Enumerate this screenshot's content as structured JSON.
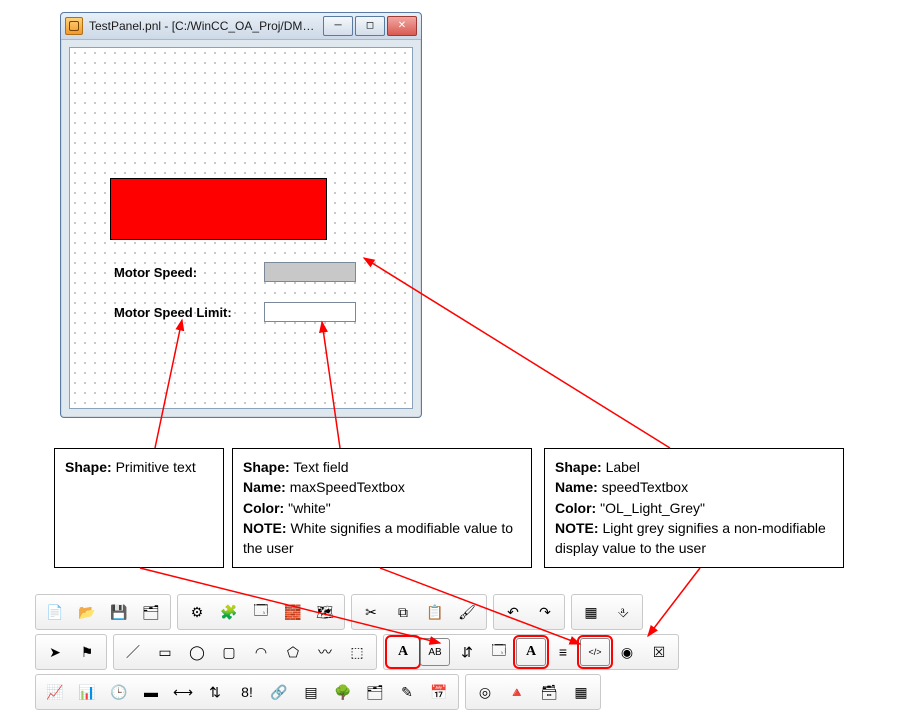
{
  "window": {
    "title": "TestPanel.pnl - [C:/WinCC_OA_Proj/DMC_Tutorial/panel..."
  },
  "panel": {
    "motor_speed_label": "Motor Speed:",
    "motor_speed_limit_label": "Motor Speed Limit:"
  },
  "callouts": {
    "primitive_text": {
      "shape_key": "Shape:",
      "shape_val": "Primitive text"
    },
    "text_field": {
      "shape_key": "Shape:",
      "shape_val": "Text field",
      "name_key": "Name:",
      "name_val": "maxSpeedTextbox",
      "color_key": "Color:",
      "color_val": "\"white\"",
      "note_key": "NOTE:",
      "note_val": "White signifies a modifiable value to the user"
    },
    "label_shape": {
      "shape_key": "Shape:",
      "shape_val": "Label",
      "name_key": "Name:",
      "name_val": "speedTextbox",
      "color_key": "Color:",
      "color_val": "\"OL_Light_Grey\"",
      "note_key": "NOTE:",
      "note_val": "Light grey signifies a non-modifiable display value to the user"
    }
  },
  "toolbar_icons": {
    "row1": [
      "new-file-icon",
      "open-folder-icon",
      "save-icon",
      "save-all-icon",
      "gear-icon",
      "module-icon",
      "panel-manager-icon",
      "tree-icon",
      "hierarchy-icon",
      "cut-icon",
      "copy-icon",
      "paste-icon",
      "format-painter-icon",
      "undo-icon",
      "redo-icon",
      "snap-grid-icon",
      "anchor-icon"
    ],
    "row2": [
      "pointer-icon",
      "flag-icon",
      "line-icon",
      "rectangle-icon",
      "ellipse-icon",
      "rounded-rect-icon",
      "arc-icon",
      "polygon-icon",
      "freeform-icon",
      "button-icon",
      "primitive-text-icon",
      "text-field-icon",
      "spin-icon",
      "frame-icon",
      "label-icon",
      "combobox-icon",
      "code-label-icon",
      "radio-icon",
      "close-x-icon"
    ],
    "row3": [
      "trend-icon",
      "bar-chart-icon",
      "clock-icon",
      "progress-icon",
      "slider-icon",
      "spin-box-icon",
      "numeric-io-icon",
      "link-icon",
      "table-icon",
      "tree-view-icon",
      "tab-icon",
      "script-editor-icon",
      "calendar-icon",
      "radio-dot-icon",
      "cone-icon",
      "layers-icon",
      "grid-table-icon"
    ]
  },
  "glyphs": {
    "new-file-icon": "📄",
    "open-folder-icon": "📂",
    "save-icon": "💾",
    "save-all-icon": "🗂",
    "gear-icon": "⚙",
    "module-icon": "🧩",
    "panel-manager-icon": "🗔",
    "tree-icon": "🧱",
    "hierarchy-icon": "🗺",
    "cut-icon": "✂",
    "copy-icon": "⧉",
    "paste-icon": "📋",
    "format-painter-icon": "🖌",
    "undo-icon": "↶",
    "redo-icon": "↷",
    "snap-grid-icon": "▦",
    "anchor-icon": "⎀",
    "pointer-icon": "➤",
    "flag-icon": "⚑",
    "line-icon": "／",
    "rectangle-icon": "▭",
    "ellipse-icon": "◯",
    "rounded-rect-icon": "▢",
    "arc-icon": "◠",
    "polygon-icon": "⬠",
    "freeform-icon": "〰",
    "button-icon": "⬚",
    "primitive-text-icon": "A",
    "text-field-icon": "AB",
    "spin-icon": "⇵",
    "frame-icon": "🗔",
    "label-icon": "A",
    "combobox-icon": "≡",
    "code-label-icon": "</>",
    "radio-icon": "◉",
    "close-x-icon": "☒",
    "trend-icon": "📈",
    "bar-chart-icon": "📊",
    "clock-icon": "🕒",
    "progress-icon": "▬",
    "slider-icon": "⟷",
    "spin-box-icon": "⇅",
    "numeric-io-icon": "8!",
    "link-icon": "🔗",
    "table-icon": "▤",
    "tree-view-icon": "🌳",
    "tab-icon": "🗂",
    "script-editor-icon": "✎",
    "calendar-icon": "📅",
    "radio-dot-icon": "◎",
    "cone-icon": "🔺",
    "layers-icon": "🗃",
    "grid-table-icon": "▦"
  },
  "highlighted_tools": [
    "primitive-text-icon",
    "label-icon",
    "code-label-icon"
  ]
}
